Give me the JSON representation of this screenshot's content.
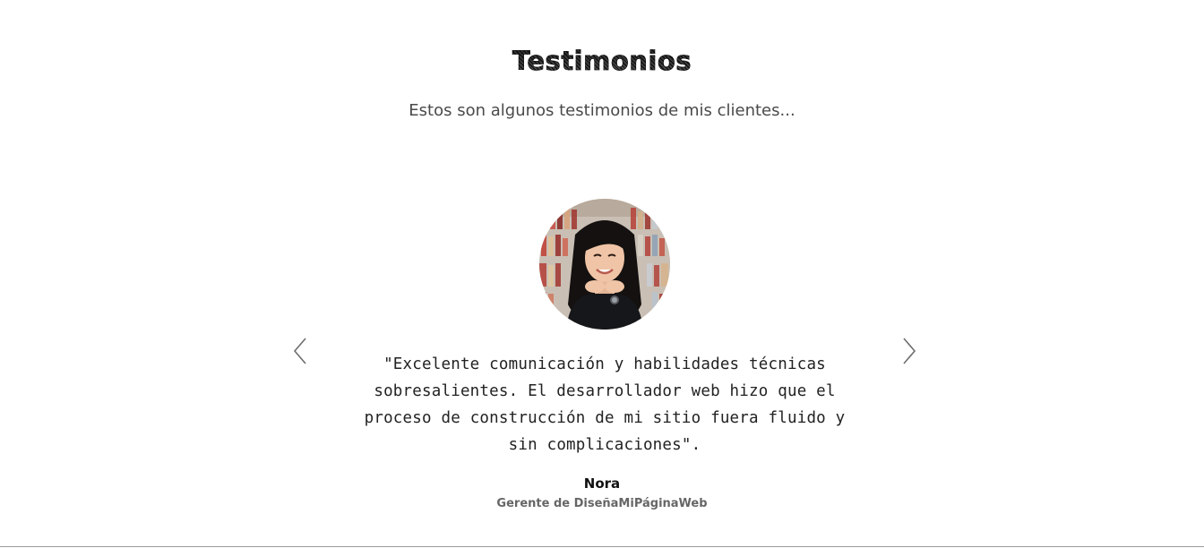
{
  "testimonials": {
    "title": "Testimonios",
    "subtitle": "Estos son algunos testimonios de mis clientes...",
    "current": {
      "quote": "\"Excelente comunicación y habilidades técnicas sobresalientes. El desarrollador web hizo que el proceso de construcción de mi sitio fuera fluido y sin complicaciones\".",
      "author": "Nora",
      "role": "Gerente de DiseñaMiPáginaWeb"
    },
    "controls": {
      "prev_icon": "chevron-left-icon",
      "next_icon": "chevron-right-icon"
    }
  },
  "colors": {
    "background": "#ffffff",
    "text": "#222222",
    "muted": "#666666",
    "arrow": "#6e6e6e"
  }
}
